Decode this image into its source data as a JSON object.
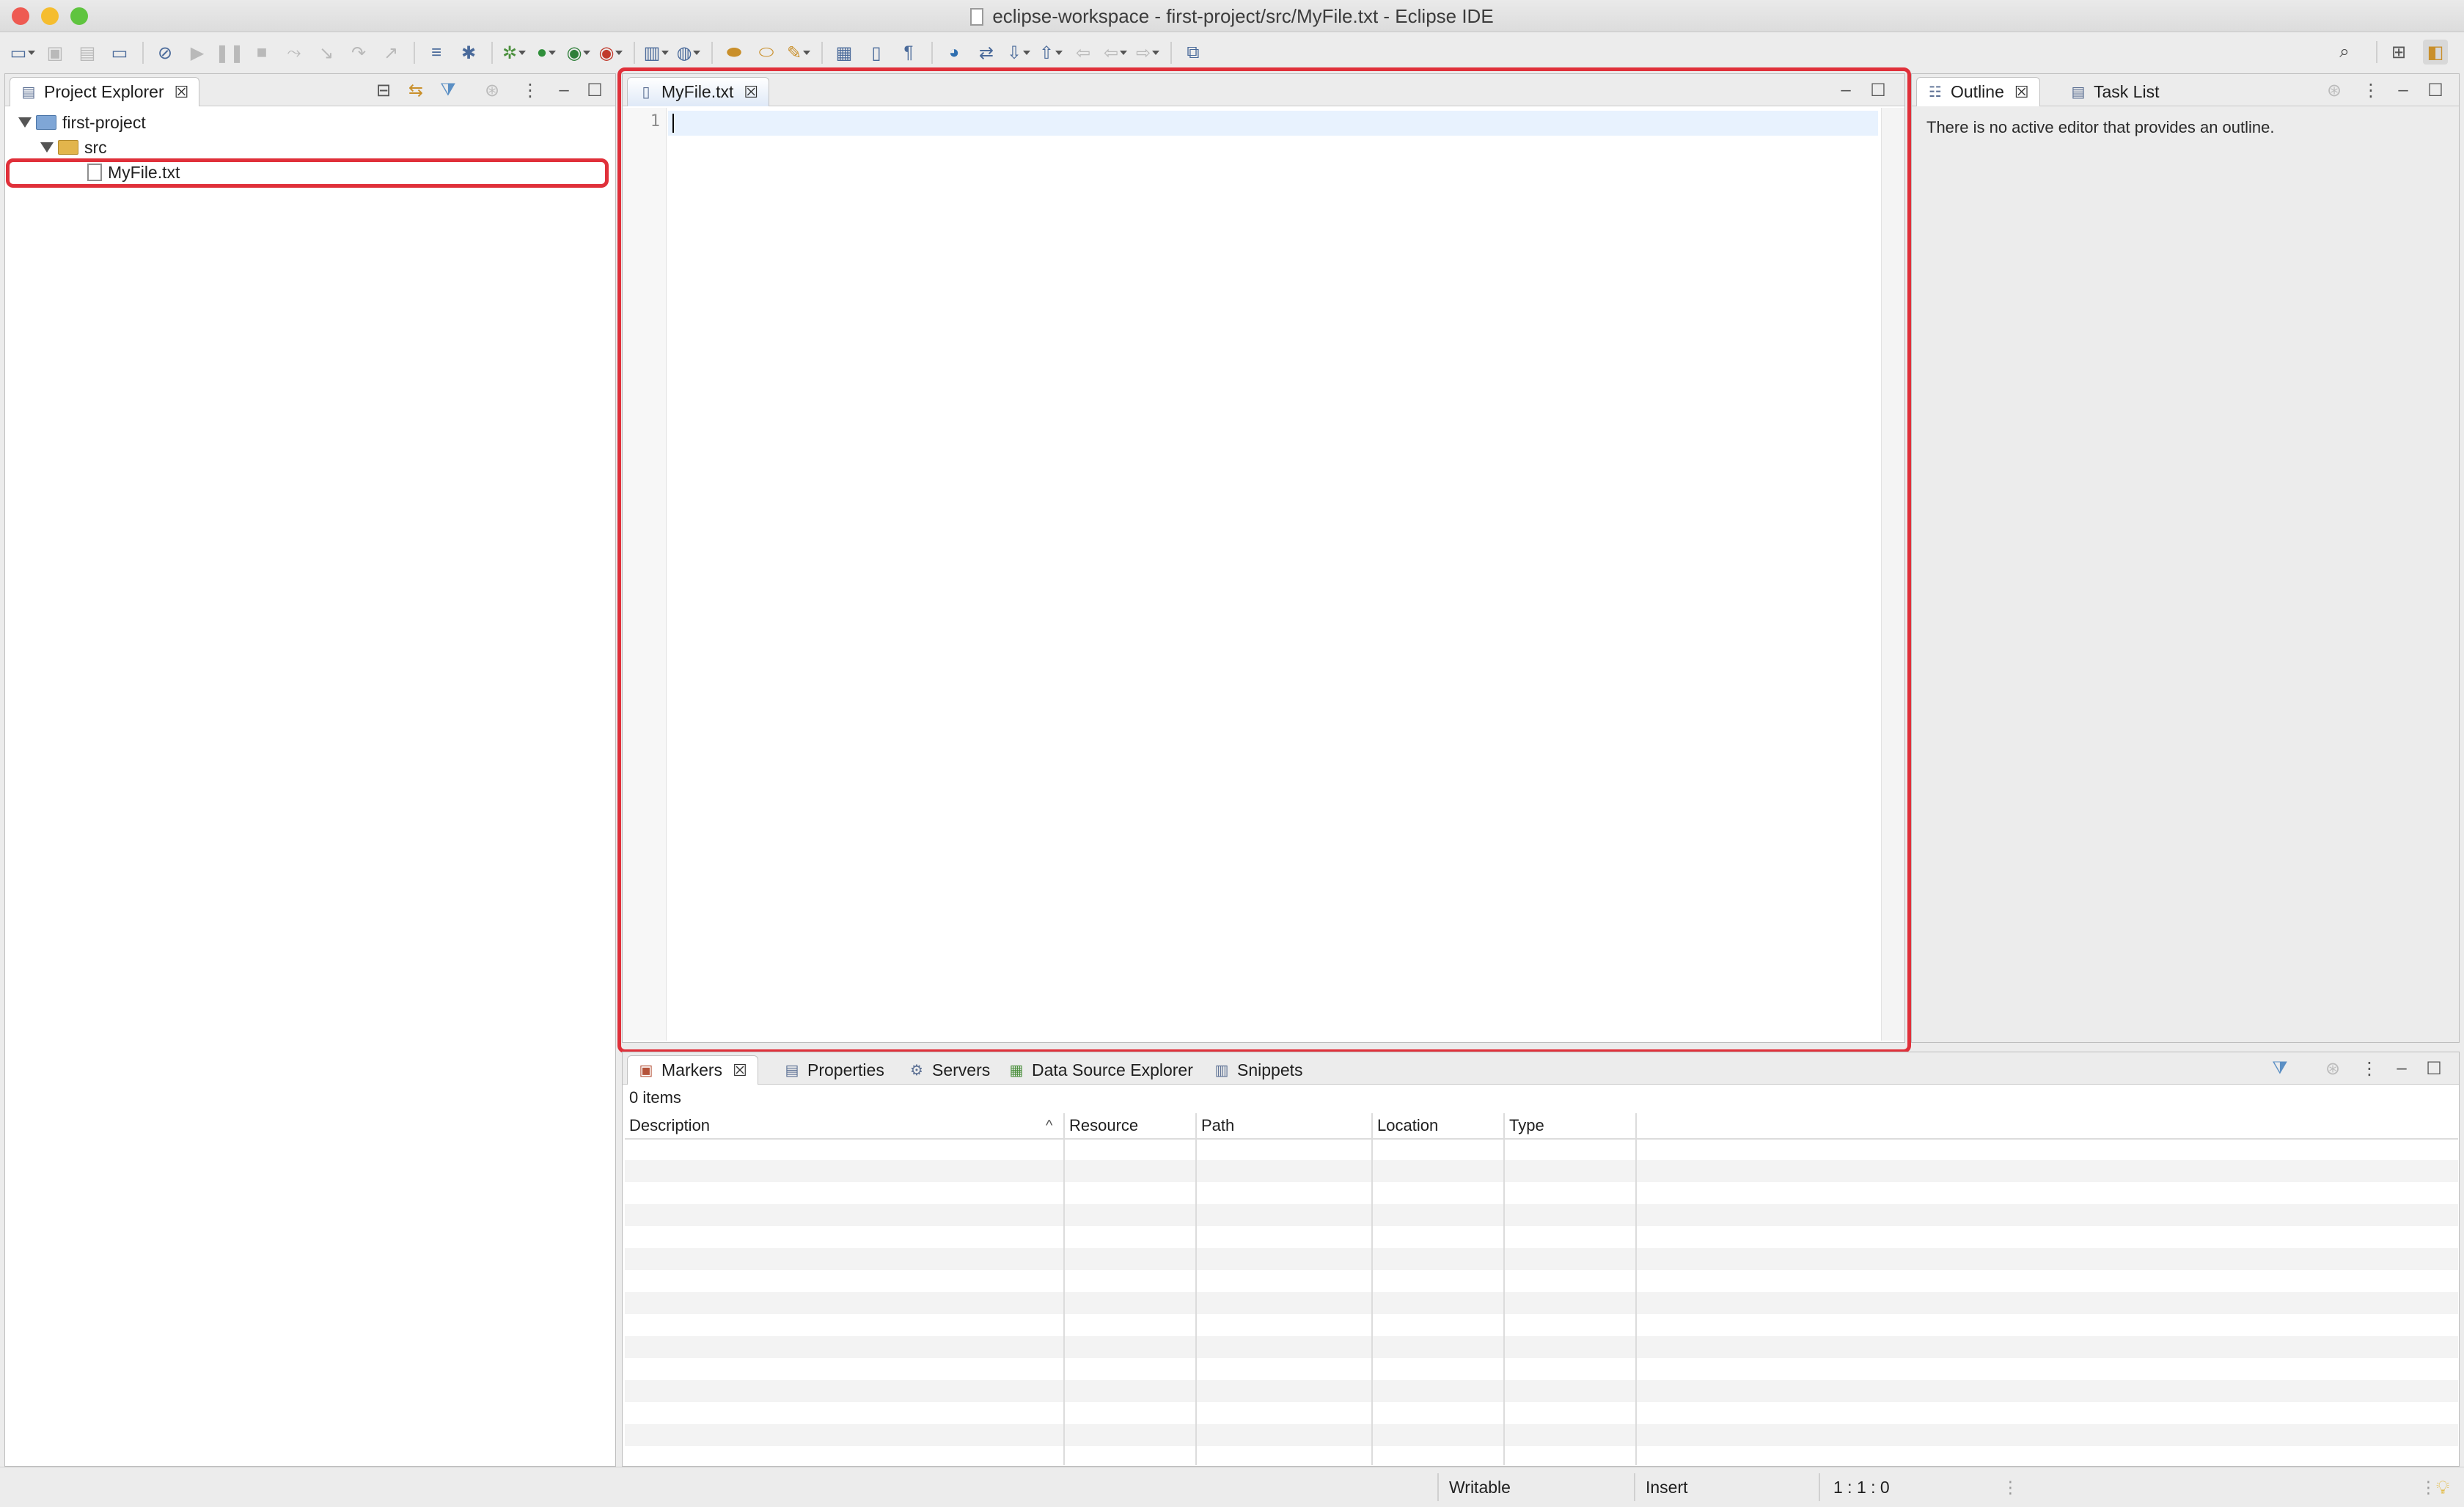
{
  "window": {
    "title": "eclipse-workspace - first-project/src/MyFile.txt - Eclipse IDE",
    "traffic_lights": {
      "close": "#ee5a52",
      "minimize": "#f5bd2f",
      "maximize": "#5fc43f"
    }
  },
  "toolbar": {
    "icons": [
      "new-icon",
      "save-icon",
      "save-all-icon",
      "terminal-icon",
      "skip-breakpoints-icon",
      "resume-icon",
      "suspend-icon",
      "terminate-icon",
      "disconnect-icon",
      "step-into-icon",
      "step-over-icon",
      "step-return-icon",
      "use-step-filters-icon",
      "debug-icon",
      "run-icon",
      "coverage-icon",
      "external-tools-icon",
      "new-server-icon",
      "new-web-icon",
      "open-type-icon",
      "open-task-icon",
      "search-icon",
      "toggle-mark-occurrences-icon",
      "show-whitespace-icon",
      "globe-icon",
      "compare-icon",
      "next-annotation-icon",
      "prev-annotation-icon",
      "back-icon",
      "forward-icon",
      "pin-editor-icon"
    ],
    "search_icon": "magnifier-icon",
    "perspective_icons": [
      "open-perspective-icon",
      "java-ee-perspective-icon"
    ]
  },
  "project_explorer": {
    "tab_label": "Project Explorer",
    "tree": {
      "project": "first-project",
      "folder": "src",
      "file": "MyFile.txt"
    }
  },
  "editor": {
    "tab_label": "MyFile.txt",
    "line_numbers": [
      "1"
    ],
    "content": ""
  },
  "outline": {
    "tabs": [
      "Outline",
      "Task List"
    ],
    "message": "There is no active editor that provides an outline."
  },
  "markers": {
    "tabs": [
      "Markers",
      "Properties",
      "Servers",
      "Data Source Explorer",
      "Snippets"
    ],
    "count_label": "0 items",
    "columns": [
      "Description",
      "Resource",
      "Path",
      "Location",
      "Type"
    ]
  },
  "status_bar": {
    "writable": "Writable",
    "insert_mode": "Insert",
    "position": "1 : 1 : 0"
  },
  "highlight_color": "#e0303a"
}
